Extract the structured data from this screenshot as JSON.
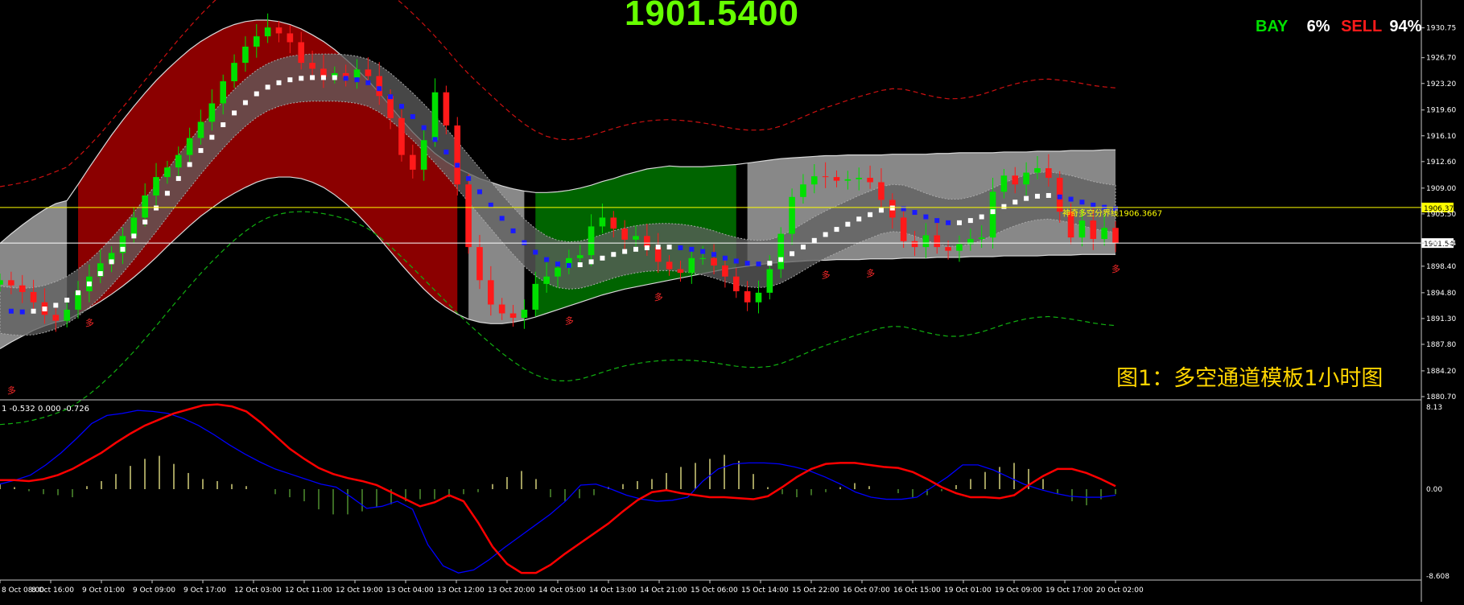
{
  "header": {
    "current_price": "1901.5400",
    "bay_label": "BAY",
    "bay_pct": "6%",
    "sell_label": "SELL",
    "sell_pct": "94%"
  },
  "caption": "图1：多空通道模板1小时图",
  "divider_label": "神奇多空分界线1906.3667",
  "chart_data": [
    {
      "type": "candlestick",
      "title": "",
      "ylim": [
        1880.7,
        1933.0
      ],
      "y_ticks": [
        "1930.75",
        "1926.70",
        "1923.20",
        "1919.60",
        "1916.10",
        "1912.60",
        "1909.00",
        "1905.50",
        "1901.54",
        "1898.40",
        "1894.80",
        "1891.30",
        "1887.80",
        "1884.20",
        "1880.70"
      ],
      "x_ticks": [
        "8 Oct 08:00",
        "8 Oct 16:00",
        "9 Oct 01:00",
        "9 Oct 09:00",
        "9 Oct 17:00",
        "12 Oct 03:00",
        "12 Oct 11:00",
        "12 Oct 19:00",
        "13 Oct 04:00",
        "13 Oct 12:00",
        "13 Oct 20:00",
        "14 Oct 05:00",
        "14 Oct 13:00",
        "14 Oct 21:00",
        "15 Oct 06:00",
        "15 Oct 14:00",
        "15 Oct 22:00",
        "16 Oct 07:00",
        "16 Oct 15:00",
        "19 Oct 01:00",
        "19 Oct 09:00",
        "19 Oct 17:00",
        "20 Oct 02:00"
      ],
      "price_tags": [
        {
          "label": "1906.37",
          "value": 1906.37,
          "color": "#ffff00"
        },
        {
          "label": "1901.54",
          "value": 1901.54,
          "color": "#ffffff"
        }
      ],
      "signal_labels": [
        "多",
        "多",
        "多",
        "多",
        "多",
        "多",
        "多"
      ],
      "close": [
        1896.5,
        1895.8,
        1894.9,
        1893.5,
        1891.8,
        1891.0,
        1892.5,
        1895.0,
        1897.0,
        1898.8,
        1900.2,
        1902.5,
        1905.0,
        1908.0,
        1910.5,
        1911.8,
        1913.5,
        1915.8,
        1918.0,
        1920.5,
        1923.5,
        1926.0,
        1928.2,
        1929.6,
        1930.8,
        1930.0,
        1928.8,
        1926.0,
        1925.2,
        1924.1,
        1924.6,
        1924.0,
        1925.1,
        1924.2,
        1921.5,
        1918.5,
        1913.5,
        1911.5,
        1915.5,
        1922.0,
        1917.5,
        1909.5,
        1901.0,
        1896.5,
        1893.2,
        1892.0,
        1891.4,
        1892.5,
        1896.0,
        1897.0,
        1898.2,
        1899.5,
        1899.9,
        1903.8,
        1905.0,
        1903.5,
        1902.0,
        1902.5,
        1901.0,
        1899.0,
        1898.0,
        1897.5,
        1899.5,
        1899.5,
        1898.5,
        1897.0,
        1895.0,
        1893.5,
        1894.8,
        1898.0,
        1902.8,
        1907.8,
        1909.5,
        1910.6,
        1910.5,
        1910.0,
        1910.2,
        1910.4,
        1909.8,
        1907.4,
        1905.0,
        1901.8,
        1901.0,
        1902.6,
        1901.0,
        1900.5,
        1901.4,
        1902.1,
        1902.3,
        1908.5,
        1910.7,
        1909.5,
        1911.1,
        1911.7,
        1910.4,
        1905.8,
        1902.3,
        1904.6,
        1902.1,
        1903.6,
        1901.5
      ],
      "upper_band": [
        1901.5,
        1902.8,
        1904.0,
        1905.1,
        1906.1,
        1906.9,
        1907.3,
        1909.5,
        1911.8,
        1914.0,
        1916.2,
        1918.2,
        1920.1,
        1921.9,
        1923.6,
        1925.1,
        1926.5,
        1927.8,
        1928.9,
        1929.8,
        1930.6,
        1931.2,
        1931.6,
        1931.8,
        1931.8,
        1931.6,
        1931.2,
        1930.6,
        1929.8,
        1928.9,
        1927.8,
        1926.5,
        1925.1,
        1923.6,
        1921.9,
        1920.1,
        1918.3,
        1916.6,
        1915.1,
        1913.7,
        1912.6,
        1911.7,
        1911.0,
        1910.3,
        1909.8,
        1909.3,
        1908.9,
        1908.6,
        1908.4,
        1908.4,
        1908.5,
        1908.7,
        1909.0,
        1909.4,
        1909.9,
        1910.3,
        1910.8,
        1911.2,
        1911.6,
        1911.8,
        1912.0,
        1911.9,
        1911.9,
        1911.9,
        1912.0,
        1912.1,
        1912.2,
        1912.4,
        1912.6,
        1912.8,
        1913.0,
        1913.1,
        1913.2,
        1913.3,
        1913.4,
        1913.4,
        1913.5,
        1913.5,
        1913.5,
        1913.5,
        1913.6,
        1913.6,
        1913.6,
        1913.6,
        1913.7,
        1913.7,
        1913.8,
        1913.8,
        1913.8,
        1913.8,
        1913.9,
        1913.9,
        1913.9,
        1914.0,
        1914.0,
        1914.0,
        1914.1,
        1914.1,
        1914.1,
        1914.2,
        1914.2
      ],
      "lower_band": [
        1887.2,
        1888.1,
        1888.9,
        1889.7,
        1890.3,
        1890.8,
        1891.1,
        1891.9,
        1892.7,
        1893.6,
        1894.6,
        1895.7,
        1896.9,
        1898.2,
        1899.6,
        1901.1,
        1902.5,
        1903.9,
        1905.2,
        1906.3,
        1907.4,
        1908.3,
        1909.1,
        1909.8,
        1910.3,
        1910.5,
        1910.5,
        1910.3,
        1909.8,
        1909.1,
        1908.1,
        1906.9,
        1905.5,
        1903.9,
        1902.2,
        1900.4,
        1898.6,
        1896.9,
        1895.3,
        1893.9,
        1892.8,
        1891.9,
        1891.2,
        1890.8,
        1890.6,
        1890.6,
        1890.8,
        1891.1,
        1891.5,
        1892.0,
        1892.5,
        1893.0,
        1893.5,
        1894.0,
        1894.5,
        1894.9,
        1895.3,
        1895.6,
        1895.9,
        1896.2,
        1896.5,
        1896.8,
        1897.1,
        1897.4,
        1897.7,
        1898.0,
        1898.2,
        1898.4,
        1898.6,
        1898.8,
        1898.9,
        1899.0,
        1899.1,
        1899.2,
        1899.2,
        1899.3,
        1899.3,
        1899.3,
        1899.4,
        1899.4,
        1899.4,
        1899.5,
        1899.5,
        1899.5,
        1899.6,
        1899.6,
        1899.6,
        1899.7,
        1899.7,
        1899.7,
        1899.8,
        1899.8,
        1899.8,
        1899.8,
        1899.9,
        1899.9,
        1899.9,
        1900.0,
        1900.0,
        1900.0,
        1900.0
      ],
      "mid_line": [
        1892.5,
        1892.3,
        1892.2,
        1892.3,
        1892.6,
        1893.1,
        1893.8,
        1894.8,
        1896.0,
        1897.4,
        1899.0,
        1900.7,
        1902.5,
        1904.4,
        1906.3,
        1908.3,
        1910.3,
        1912.2,
        1914.1,
        1915.9,
        1917.6,
        1919.2,
        1920.6,
        1921.8,
        1922.7,
        1923.3,
        1923.7,
        1923.9,
        1924.0,
        1924.0,
        1924.0,
        1923.9,
        1923.7,
        1923.3,
        1922.5,
        1921.4,
        1920.1,
        1918.7,
        1917.2,
        1915.6,
        1913.9,
        1912.1,
        1910.3,
        1908.5,
        1906.7,
        1904.9,
        1903.2,
        1901.6,
        1900.3,
        1899.3,
        1898.7,
        1898.5,
        1898.6,
        1899.0,
        1899.5,
        1900.0,
        1900.4,
        1900.7,
        1900.9,
        1901.0,
        1901.0,
        1900.9,
        1900.7,
        1900.4,
        1900.0,
        1899.5,
        1899.1,
        1898.8,
        1898.7,
        1898.8,
        1899.3,
        1900.1,
        1901.0,
        1901.9,
        1902.7,
        1903.4,
        1904.1,
        1904.8,
        1905.4,
        1906.0,
        1906.3,
        1906.2,
        1905.7,
        1905.1,
        1904.6,
        1904.3,
        1904.3,
        1904.6,
        1905.1,
        1905.8,
        1906.5,
        1907.1,
        1907.6,
        1907.9,
        1908.0,
        1907.8,
        1907.5,
        1907.1,
        1906.7,
        1906.4,
        1906.2
      ],
      "zones": [
        {
          "from": 0,
          "to": 6,
          "color": "#888888"
        },
        {
          "from": 7,
          "to": 41,
          "color": "#8b0000"
        },
        {
          "from": 42,
          "to": 47,
          "color": "#888888"
        },
        {
          "from": 48,
          "to": 66,
          "color": "#006400"
        },
        {
          "from": 67,
          "to": 100,
          "color": "#888888"
        }
      ]
    },
    {
      "type": "line",
      "title": "MACD",
      "header_values": "1 -0.532 0.000 -0.726",
      "ylim": [
        -8.608,
        8.13
      ],
      "y_ticks": [
        "8.13",
        "0.00",
        "-8.608"
      ],
      "series": [
        {
          "color": "#ff0000",
          "values": [
            0.9,
            0.9,
            0.8,
            1.0,
            1.4,
            2.0,
            2.8,
            3.6,
            4.6,
            5.5,
            6.3,
            6.9,
            7.5,
            7.9,
            8.3,
            8.4,
            8.2,
            7.7,
            6.6,
            5.3,
            4.0,
            3.0,
            2.1,
            1.5,
            1.1,
            0.8,
            0.4,
            -0.3,
            -1.0,
            -1.7,
            -1.3,
            -0.6,
            -1.2,
            -3.3,
            -5.7,
            -7.4,
            -8.3,
            -8.3,
            -7.5,
            -6.4,
            -5.4,
            -4.4,
            -3.4,
            -2.2,
            -1.1,
            -0.3,
            -0.1,
            -0.4,
            -0.6,
            -0.8,
            -0.8,
            -0.9,
            -1.0,
            -0.7,
            0.2,
            1.2,
            2.0,
            2.5,
            2.6,
            2.6,
            2.4,
            2.2,
            2.1,
            1.7,
            1.0,
            0.2,
            -0.4,
            -0.8,
            -0.8,
            -0.9,
            -0.6,
            0.4,
            1.3,
            2.0,
            2.0,
            1.6,
            1.0,
            0.3
          ]
        },
        {
          "color": "#0000ff",
          "values": [
            0.5,
            0.9,
            1.4,
            2.4,
            3.6,
            5.0,
            6.5,
            7.3,
            7.5,
            7.8,
            7.7,
            7.5,
            7.0,
            6.3,
            5.4,
            4.4,
            3.5,
            2.7,
            2.0,
            1.5,
            1.0,
            0.5,
            0.2,
            -0.8,
            -1.9,
            -1.7,
            -1.2,
            -2.0,
            -5.5,
            -7.6,
            -8.3,
            -8.0,
            -7.0,
            -5.8,
            -4.7,
            -3.6,
            -2.5,
            -1.2,
            0.4,
            0.5,
            0.0,
            -0.6,
            -1.0,
            -1.2,
            -1.1,
            -0.8,
            0.8,
            2.0,
            2.5,
            2.6,
            2.6,
            2.5,
            2.2,
            1.8,
            1.2,
            0.5,
            -0.3,
            -0.8,
            -1.0,
            -1.0,
            -0.8,
            0.2,
            1.2,
            2.4,
            2.4,
            1.9,
            1.2,
            0.5,
            0.0,
            -0.4,
            -0.7,
            -0.8,
            -0.8,
            -0.6
          ]
        },
        {
          "color": "#d4d17a",
          "type": "histogram",
          "values": [
            0.5,
            0.2,
            -0.2,
            -0.5,
            -0.6,
            -0.8,
            0.3,
            0.8,
            1.5,
            2.3,
            3.0,
            3.3,
            2.5,
            1.6,
            1.0,
            0.8,
            0.5,
            0.3,
            0.0,
            -0.5,
            -0.8,
            -1.2,
            -2.0,
            -2.5,
            -2.5,
            -2.2,
            -1.8,
            -1.5,
            -1.2,
            -1.0,
            -1.0,
            -0.8,
            -0.5,
            -0.3,
            0.5,
            1.2,
            1.8,
            1.0,
            -0.8,
            -1.2,
            -0.9,
            -0.6,
            0.2,
            0.5,
            0.8,
            1.0,
            1.6,
            2.2,
            2.6,
            3.0,
            3.4,
            2.8,
            1.5,
            0.2,
            -0.5,
            -0.8,
            -0.6,
            -0.3,
            0.2,
            0.6,
            0.3,
            0.0,
            -0.4,
            -0.8,
            -0.6,
            -0.2,
            0.4,
            1.0,
            1.7,
            2.2,
            2.6,
            2.0,
            1.0,
            -0.5,
            -1.2,
            -1.6,
            -1.0,
            -0.5
          ]
        }
      ]
    }
  ]
}
